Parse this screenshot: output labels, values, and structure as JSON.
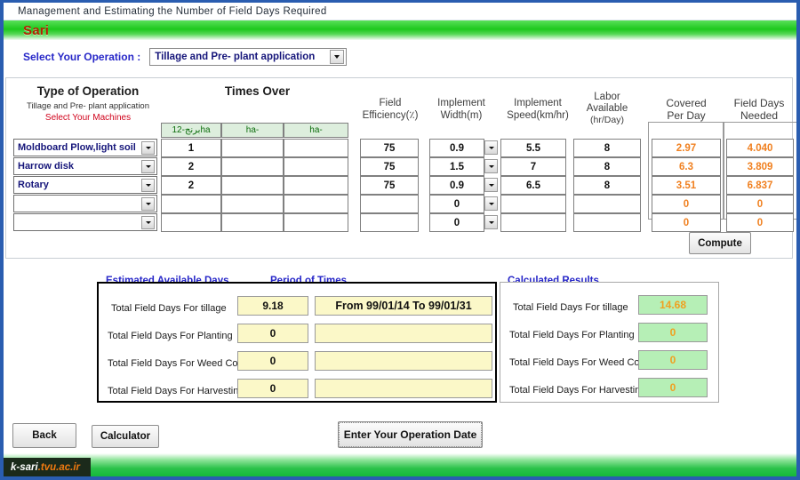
{
  "window": {
    "title": "Management and Estimating the Number of Field Days Required",
    "banner_city": "Sari"
  },
  "operation_selector": {
    "label": "Select Your Operation :",
    "value": "Tillage and Pre- plant application"
  },
  "table": {
    "headers": {
      "type_of_operation": "Type of Operation",
      "type_of_operation_sub": "Tillage and Pre- plant application",
      "select_machines": "Select Your Machines",
      "times_over": "Times Over",
      "field_efficiency": "Field\nEfficiency(٪)",
      "field_efficiency_l1": "Field",
      "field_efficiency_l2": "Efficiency(٪)",
      "implement_width_l1": "Implement",
      "implement_width_l2": "Width(m)",
      "implement_speed_l1": "Implement",
      "implement_speed_l2": "Speed(km/hr)",
      "labor_available_l1": "Labor",
      "labor_available_l2": "Available",
      "labor_available_l3": "(hr/Day)",
      "covered_per_day_l1": "Covered",
      "covered_per_day_l2": "Per Day",
      "field_days_needed_l1": "Field Days",
      "field_days_needed_l2": "Needed"
    },
    "times_over_columns": [
      "برنج-12ha",
      "ha-",
      "ha-"
    ],
    "rows": [
      {
        "machine": "Moldboard Plow,light soil",
        "times_over": [
          "1",
          "",
          ""
        ],
        "field_efficiency": "75",
        "implement_width": "0.9",
        "implement_speed": "5.5",
        "labor_available": "8",
        "covered_per_day": "2.97",
        "field_days_needed": "4.040"
      },
      {
        "machine": "Harrow disk",
        "times_over": [
          "2",
          "",
          ""
        ],
        "field_efficiency": "75",
        "implement_width": "1.5",
        "implement_speed": "7",
        "labor_available": "8",
        "covered_per_day": "6.3",
        "field_days_needed": "3.809"
      },
      {
        "machine": "Rotary",
        "times_over": [
          "2",
          "",
          ""
        ],
        "field_efficiency": "75",
        "implement_width": "0.9",
        "implement_speed": "6.5",
        "labor_available": "8",
        "covered_per_day": "3.51",
        "field_days_needed": "6.837"
      },
      {
        "machine": "",
        "times_over": [
          "",
          "",
          ""
        ],
        "field_efficiency": "",
        "implement_width": "0",
        "implement_speed": "",
        "labor_available": "",
        "covered_per_day": "0",
        "field_days_needed": "0"
      },
      {
        "machine": "",
        "times_over": [
          "",
          "",
          ""
        ],
        "field_efficiency": "",
        "implement_width": "0",
        "implement_speed": "",
        "labor_available": "",
        "covered_per_day": "0",
        "field_days_needed": "0"
      }
    ],
    "compute_label": "Compute"
  },
  "estimated_available_days": {
    "group_title": "Estimated Available Days",
    "period_title": "Period  of  Times",
    "rows": [
      {
        "label": "Total Field Days For  tillage",
        "days": "9.18",
        "period": "From  99/01/14  To  99/01/31"
      },
      {
        "label": "Total Field Days For Planting",
        "days": "0",
        "period": ""
      },
      {
        "label": "Total Field Days For Weed Control",
        "days": "0",
        "period": ""
      },
      {
        "label": "Total Field Days For Harvesting",
        "days": "0",
        "period": ""
      }
    ]
  },
  "calculated_results": {
    "group_title": "Calculated Results",
    "rows": [
      {
        "label": "Total Field Days For  tillage",
        "value": "14.68"
      },
      {
        "label": "Total Field Days For Planting",
        "value": "0"
      },
      {
        "label": "Total Field Days For Weed Control",
        "value": "0"
      },
      {
        "label": "Total Field Days For Harvesting",
        "value": "0"
      }
    ]
  },
  "actions": {
    "back": "Back",
    "calculator": "Calculator",
    "enter_operation_date": "Enter Your Operation Date"
  },
  "footer": {
    "logo_primary": "k-sari",
    "logo_secondary": ".tvu.ac.ir"
  },
  "colors": {
    "accent_blue": "#2727c8",
    "banner_green": "#1dc81d",
    "city_red": "#b22000",
    "result_orange": "#f08020",
    "yellow_field": "#fbf8c8",
    "green_field": "#b6efb6"
  }
}
